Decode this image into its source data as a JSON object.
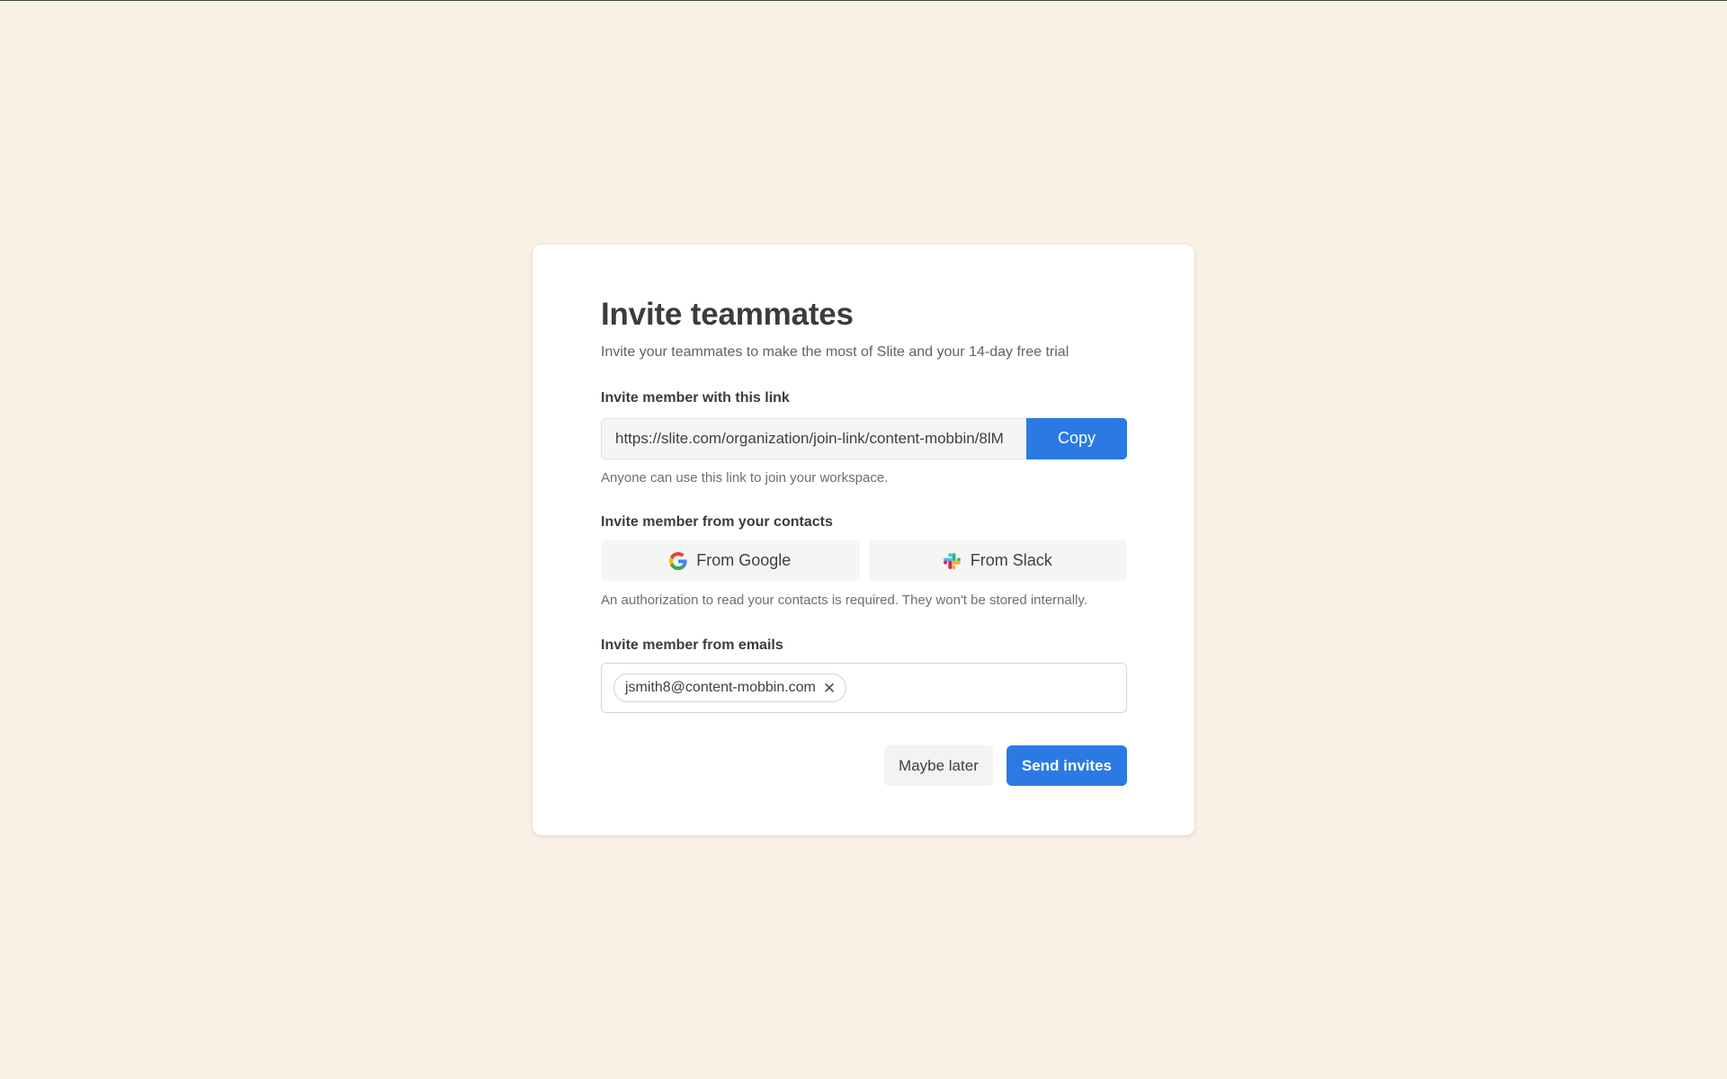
{
  "modal": {
    "title": "Invite teammates",
    "subtitle": "Invite your teammates to make the most of Slite and your 14-day free trial"
  },
  "link_section": {
    "label": "Invite member with this link",
    "link_value": "https://slite.com/organization/join-link/content-mobbin/8lM",
    "copy_label": "Copy",
    "hint": "Anyone can use this link to join your workspace."
  },
  "contacts_section": {
    "label": "Invite member from your contacts",
    "google": {
      "label": "From Google",
      "icon": "google-icon"
    },
    "slack": {
      "label": "From Slack",
      "icon": "slack-icon"
    },
    "hint": "An authorization to read your contacts is required. They won't be stored internally."
  },
  "emails_section": {
    "label": "Invite member from emails",
    "chips": [
      {
        "email": "jsmith8@content-mobbin.com",
        "remove_icon": "close-icon"
      }
    ]
  },
  "actions": {
    "maybe_later_label": "Maybe later",
    "send_label": "Send invites"
  },
  "colors": {
    "background": "#f9f0e6",
    "accent": "#2b7ae4",
    "panel": "#ffffff"
  }
}
